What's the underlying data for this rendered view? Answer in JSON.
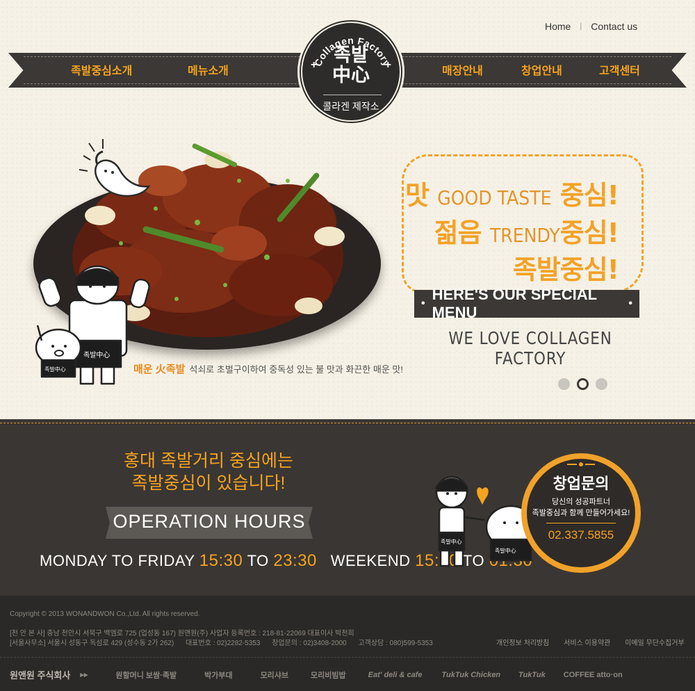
{
  "top_links": {
    "home": "Home",
    "separator": "|",
    "contact": "Contact us"
  },
  "nav": [
    {
      "label": "족발중심소개"
    },
    {
      "label": "메뉴소개"
    },
    {
      "label": "매장안내"
    },
    {
      "label": "창업안내"
    },
    {
      "label": "고객센터"
    }
  ],
  "logo": {
    "arc_text": "Collagen Factory",
    "main": "족발\n中心",
    "main_line1": "족발",
    "main_line2": "中心",
    "sub": "콜라겐 제작소",
    "plus": "+"
  },
  "hero": {
    "slogan_line1_ko": "맛",
    "slogan_line1_en": "GOOD TASTE",
    "slogan_line1_end": "중심!",
    "slogan_line2_ko": "젊음",
    "slogan_line2_en": "TRENDY",
    "slogan_line2_end": "중심!",
    "slogan_line3": "족발중심!",
    "special": "HERE'S OUR SPECIAL MENU",
    "love": "WE LOVE COLLAGEN FACTORY",
    "caption_highlight": "매운 火족발",
    "caption_text": "석쇠로 초벌구이하여 중독성 있는 불 맛과 화끈한 매운 맛!",
    "chef_apron": "족발中心",
    "pig_apron": "족발中心",
    "slide_count": 3,
    "active_slide": 2
  },
  "operation": {
    "headline_line1": "홍대 족발거리 중심에는",
    "headline_line2": "족발중심이 있습니다!",
    "title": "OPERATION HOURS",
    "weekday_label": "MONDAY TO FRIDAY",
    "weekday_open": "15:30",
    "to": "TO",
    "weekday_close": "23:30",
    "weekend_label": "WEEKEND",
    "weekend_open": "15:30",
    "weekend_close": "01:30",
    "duo_apron": "족발中心"
  },
  "franchise": {
    "title": "창업문의",
    "desc_line1": "당신의 성공파트너",
    "desc_line2": "족발중심과 함께 만들어가세요!",
    "phone": "02.337.5855"
  },
  "footer": {
    "copyright": "Copyright © 2013 WONANDWON Co.,Ltd. All rights reserved.",
    "address1": "[천 안 본 사] 충남 천안시 서북구 백엠로 725 (업성동 167) 원앤원(주) 사업자 등록번호 : 218-81-22069 대표이사 박천희",
    "address2_office": "[서울사무소] 서울시 성동구 독섬로 429 (성수동 2가 262)",
    "address2_tel": "대표번호 : 02)2282-5353",
    "address2_inquiry": "창업문의 : 02)3408-2000",
    "address2_consult": "고객상담 : 080)599-5353",
    "links": [
      "개인정보 처리방침",
      "서비스 이용약관",
      "이메일 무단수집거부"
    ],
    "brands": [
      "원앤원 주식회사",
      "▸▸",
      "원할머니 보쌈·족발",
      "박가부대",
      "모리샤브",
      "모리비빔밥",
      "Eat' deli & cafe",
      "TukTuk Chicken",
      "TukTuk",
      "COFFEE atto·on"
    ]
  },
  "colors": {
    "accent": "#f5a31e",
    "dark": "#3b3835",
    "paper": "#f6f1e6",
    "footer": "#2b2927"
  }
}
